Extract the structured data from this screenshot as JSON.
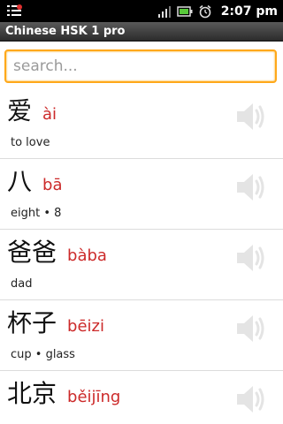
{
  "status_bar": {
    "time": "2:07 pm",
    "icons": [
      "notification-list-icon",
      "signal-icon",
      "battery-icon",
      "alarm-icon"
    ]
  },
  "title_bar": {
    "title": "Chinese HSK 1 pro"
  },
  "search": {
    "placeholder": "search..."
  },
  "words": [
    {
      "hanzi": "爱",
      "pinyin": "ài",
      "meaning": "to love"
    },
    {
      "hanzi": "八",
      "pinyin": "bā",
      "meaning": "eight • 8"
    },
    {
      "hanzi": "爸爸",
      "pinyin": "bàba",
      "meaning": "dad"
    },
    {
      "hanzi": "杯子",
      "pinyin": "bēizi",
      "meaning": "cup • glass"
    },
    {
      "hanzi": "北京",
      "pinyin": "běijīng",
      "meaning": ""
    }
  ],
  "colors": {
    "pinyin": "#cc2a2a",
    "search_focus": "#ffa81a",
    "title_bar": "#3a3a3a"
  }
}
